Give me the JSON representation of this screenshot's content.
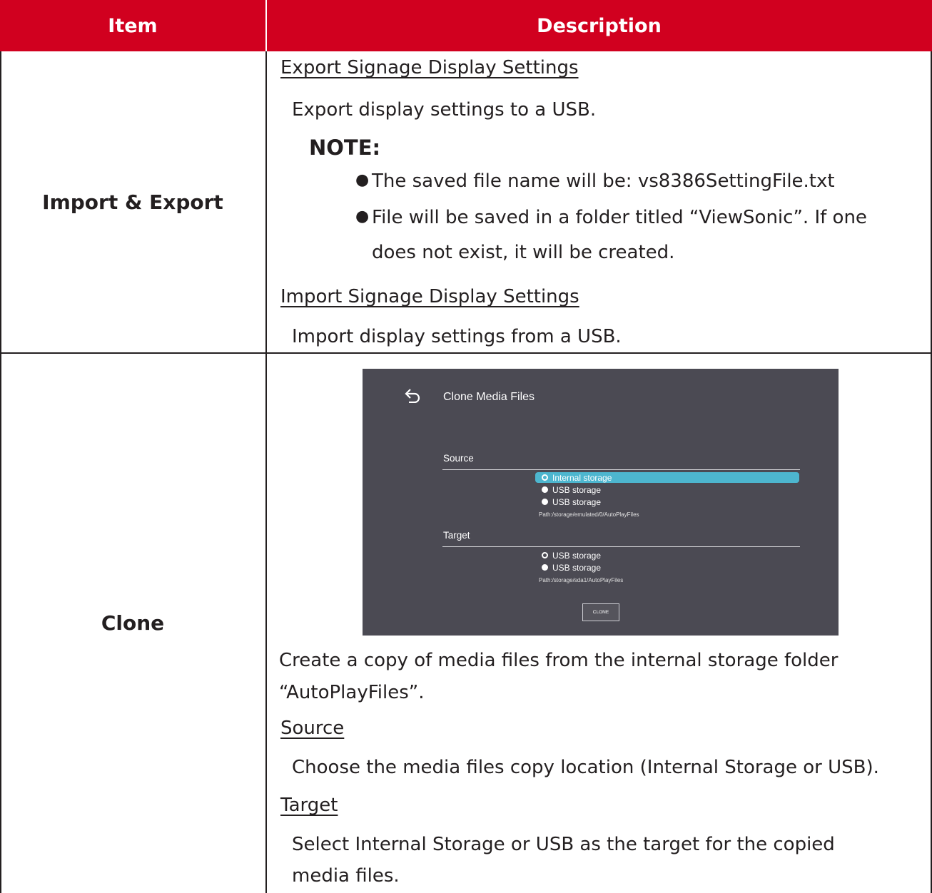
{
  "table": {
    "header": {
      "item": "Item",
      "description": "Description"
    },
    "colors": {
      "header_bg": "#d1001f",
      "header_text": "#ffffff",
      "border": "#231f20"
    }
  },
  "row_import_export": {
    "item": "Import & Export",
    "export_heading": "Export Signage Display Settings",
    "export_desc": "Export display settings to a USB.",
    "note_label": "NOTE:",
    "bullets": [
      "The saved file name will be: vs8386SettingFile.txt",
      "File will be saved in a folder titled “ViewSonic”. If one",
      "does not exist, it will be created."
    ],
    "import_heading": "Import Signage Display Settings",
    "import_desc": "Import display settings from a USB."
  },
  "row_clone": {
    "item": "Clone",
    "screenshot": {
      "title": "Clone Media Files",
      "back_icon": "back-arrow-icon",
      "source_label": "Source",
      "source_options": [
        "Internal storage",
        "USB storage",
        "USB storage"
      ],
      "source_selected_index": 0,
      "source_path": "Path:/storage/emulated/0/AutoPlayFiles",
      "target_label": "Target",
      "target_options": [
        "USB storage",
        "USB storage"
      ],
      "target_selected_index": 0,
      "target_path": "Path:/storage/sda1/AutoPlayFiles",
      "clone_button": "CLONE",
      "colors": {
        "background": "#4b4a53",
        "highlight": "#4db6cf"
      }
    },
    "desc_line1": "Create a copy of media files from the internal storage folder",
    "desc_line2": "“AutoPlayFiles”.",
    "source_heading": "Source",
    "source_desc": "Choose the media files copy location (Internal Storage or USB).",
    "target_heading": "Target",
    "target_desc_line1": "Select Internal Storage or USB as the target for the copied",
    "target_desc_line2": "media files."
  }
}
